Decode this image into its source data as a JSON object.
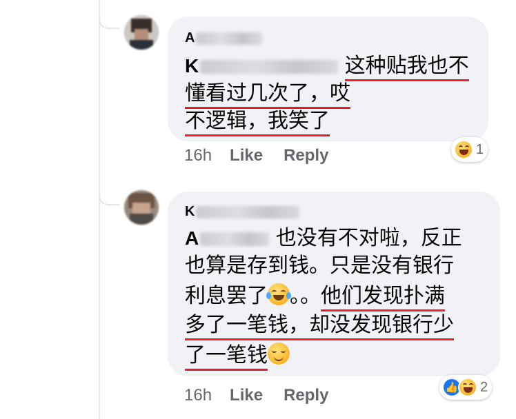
{
  "comments": [
    {
      "author_visible": "A",
      "text_lines": [
        {
          "mention": "K",
          "plain": "",
          "underlined": "这种贴我也不"
        },
        {
          "plain": "",
          "underlined": "懂看过几次了，哎"
        },
        {
          "plain": "",
          "underlined": "不逻辑，我笑了"
        }
      ],
      "time": "16h",
      "like_label": "Like",
      "reply_label": "Reply",
      "reaction_count": "1",
      "reaction_icons": [
        "haha-icon"
      ]
    },
    {
      "author_visible": "K",
      "text_lines": [
        {
          "mention": "A",
          "plain": "也没有不对啦，反正"
        },
        {
          "plain": "也算是存到钱。只是没有银行"
        },
        {
          "plain": "利息罢了",
          "emoji": "joy-emoji",
          "after": "。。",
          "underlined": "他们发现扑满"
        },
        {
          "underlined": "多了一笔钱，却没发现银行少"
        },
        {
          "underlined": "了一笔钱",
          "emoji2": "relieved-emoji"
        }
      ],
      "time": "16h",
      "like_label": "Like",
      "reply_label": "Reply",
      "reaction_count": "2",
      "reaction_icons": [
        "like-icon",
        "haha-icon"
      ]
    }
  ]
}
